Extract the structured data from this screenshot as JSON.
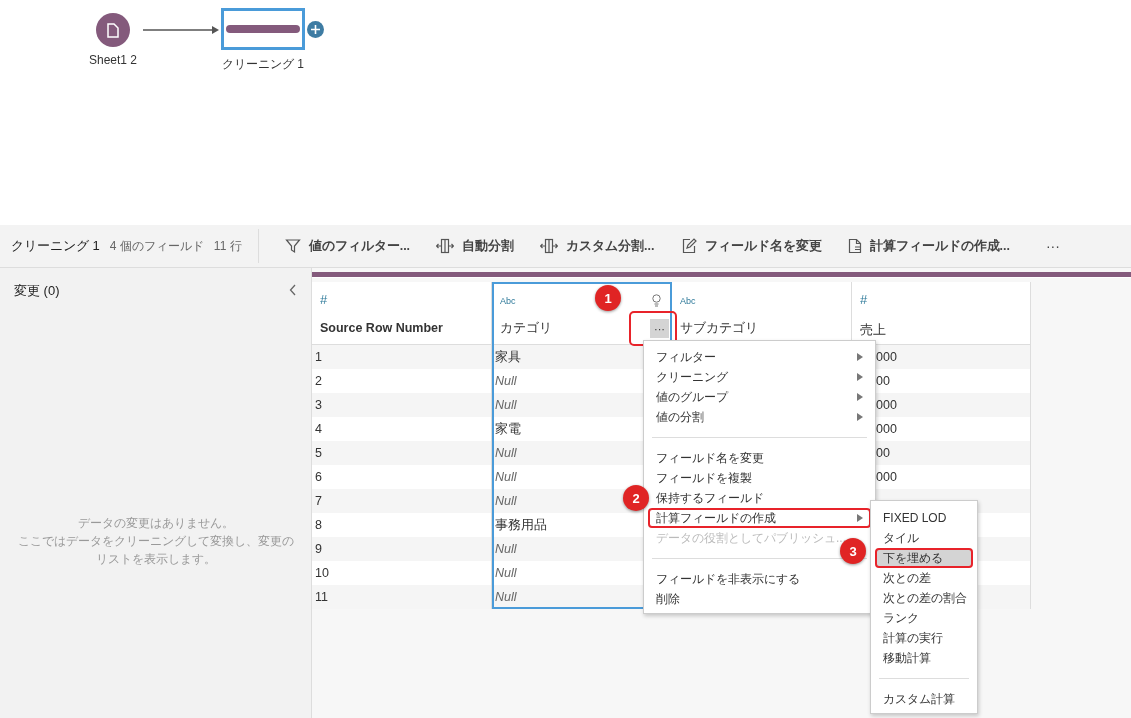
{
  "flow": {
    "nodes": [
      {
        "kind": "input",
        "label": "Sheet1 2",
        "selected": false
      },
      {
        "kind": "clean",
        "label": "クリーニング 1",
        "selected": true
      }
    ]
  },
  "toolbar": {
    "title": "クリーニング 1",
    "field_count": "4 個のフィールド",
    "row_count": "11 行",
    "actions": [
      {
        "kind": "filter",
        "label": "値のフィルター..."
      },
      {
        "kind": "split",
        "label": "自動分割"
      },
      {
        "kind": "split",
        "label": "カスタム分割..."
      },
      {
        "kind": "rename",
        "label": "フィールド名を変更"
      },
      {
        "kind": "calc",
        "label": "計算フィールドの作成..."
      }
    ],
    "more": "···"
  },
  "changes_panel": {
    "title": "変更 (0)",
    "empty_message": [
      "データの変更はありません。",
      "ここではデータをクリーニングして変換し、変更のリストを表示します。"
    ]
  },
  "table": {
    "columns": [
      {
        "type": "#",
        "name": "Source Row Number",
        "bold": true,
        "selected": false
      },
      {
        "type": "Abc",
        "name": "カテゴリ",
        "bold": false,
        "selected": true,
        "menu_button": {
          "label": "···",
          "outlined": true
        }
      },
      {
        "type": "Abc",
        "name": "サブカテゴリ",
        "bold": false,
        "selected": false
      },
      {
        "type": "#",
        "name": "売上",
        "bold": false,
        "selected": false
      }
    ],
    "rows": [
      {
        "number": "1",
        "category": {
          "text": "家具",
          "null": false
        },
        "sales": "000"
      },
      {
        "number": "2",
        "category": {
          "text": "Null",
          "null": true
        },
        "sales": "00"
      },
      {
        "number": "3",
        "category": {
          "text": "Null",
          "null": true
        },
        "sales": "000"
      },
      {
        "number": "4",
        "category": {
          "text": "家電",
          "null": false
        },
        "sales": "000"
      },
      {
        "number": "5",
        "category": {
          "text": "Null",
          "null": true
        },
        "sales": "00"
      },
      {
        "number": "6",
        "category": {
          "text": "Null",
          "null": true
        },
        "sales": "000"
      },
      {
        "number": "7",
        "category": {
          "text": "Null",
          "null": true
        }
      },
      {
        "number": "8",
        "category": {
          "text": "事務用品",
          "null": false
        }
      },
      {
        "number": "9",
        "category": {
          "text": "Null",
          "null": true
        }
      },
      {
        "number": "10",
        "category": {
          "text": "Null",
          "null": true
        }
      },
      {
        "number": "11",
        "category": {
          "text": "Null",
          "null": true
        }
      }
    ]
  },
  "context_menu": {
    "items": [
      {
        "kind": "item",
        "label": "フィルター",
        "submenu": true,
        "disabled": false,
        "outlined": false
      },
      {
        "kind": "item",
        "label": "クリーニング",
        "submenu": true,
        "disabled": false,
        "outlined": false
      },
      {
        "kind": "item",
        "label": "値のグループ",
        "submenu": true,
        "disabled": false,
        "outlined": false
      },
      {
        "kind": "item",
        "label": "値の分割",
        "submenu": true,
        "disabled": false,
        "outlined": false
      },
      {
        "kind": "separator"
      },
      {
        "kind": "item",
        "label": "フィールド名を変更",
        "submenu": false,
        "disabled": false,
        "outlined": false
      },
      {
        "kind": "item",
        "label": "フィールドを複製",
        "submenu": false,
        "disabled": false,
        "outlined": false
      },
      {
        "kind": "item",
        "label": "保持するフィールド",
        "submenu": false,
        "disabled": false,
        "outlined": false
      },
      {
        "kind": "item",
        "label": "計算フィールドの作成",
        "submenu": true,
        "disabled": false,
        "outlined": true
      },
      {
        "kind": "item",
        "label": "データの役割としてパブリッシュ...",
        "submenu": false,
        "disabled": true,
        "outlined": false
      },
      {
        "kind": "separator"
      },
      {
        "kind": "item",
        "label": "フィールドを非表示にする",
        "submenu": false,
        "disabled": false,
        "outlined": false
      },
      {
        "kind": "item",
        "label": "削除",
        "submenu": false,
        "disabled": false,
        "outlined": false
      }
    ]
  },
  "submenu": {
    "items": [
      {
        "kind": "item",
        "label": "FIXED LOD",
        "selected": false,
        "outlined": false
      },
      {
        "kind": "item",
        "label": "タイル",
        "selected": false,
        "outlined": false
      },
      {
        "kind": "item",
        "label": "下を埋める",
        "selected": true,
        "outlined": true
      },
      {
        "kind": "item",
        "label": "次との差",
        "selected": false,
        "outlined": false
      },
      {
        "kind": "item",
        "label": "次との差の割合",
        "selected": false,
        "outlined": false
      },
      {
        "kind": "item",
        "label": "ランク",
        "selected": false,
        "outlined": false
      },
      {
        "kind": "item",
        "label": "計算の実行",
        "selected": false,
        "outlined": false
      },
      {
        "kind": "item",
        "label": "移動計算",
        "selected": false,
        "outlined": false
      },
      {
        "kind": "separator"
      },
      {
        "kind": "item",
        "label": "カスタム計算",
        "selected": false,
        "outlined": false
      }
    ]
  },
  "annotations": [
    {
      "number": "1"
    },
    {
      "number": "2"
    },
    {
      "number": "3"
    }
  ]
}
